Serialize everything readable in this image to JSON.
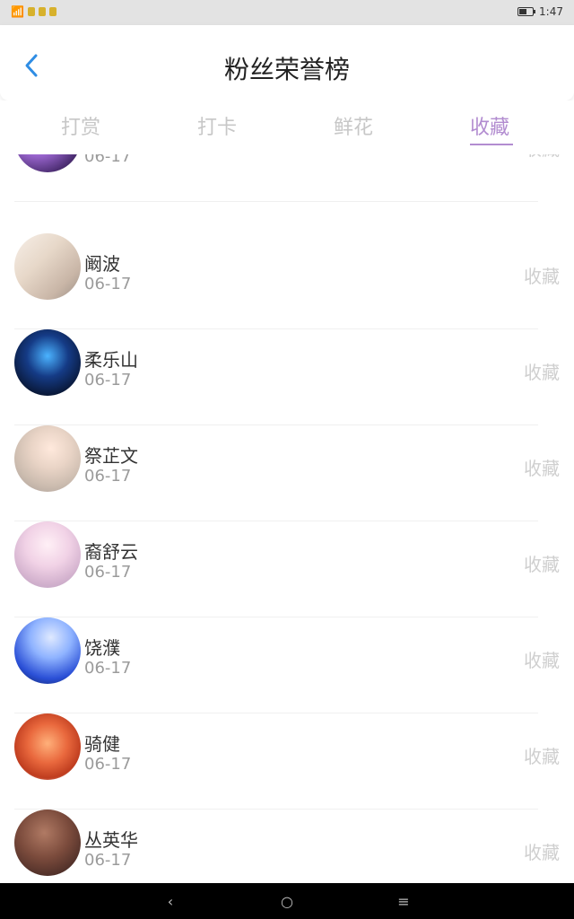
{
  "status": {
    "time": "1:47"
  },
  "header": {
    "title": "粉丝荣誉榜"
  },
  "tabs": [
    {
      "label": "打赏",
      "active": false
    },
    {
      "label": "打卡",
      "active": false
    },
    {
      "label": "鲜花",
      "active": false
    },
    {
      "label": "收藏",
      "active": true
    }
  ],
  "list": [
    {
      "name": "",
      "date": "06-17",
      "action": "收藏"
    },
    {
      "name": "阚波",
      "date": "06-17",
      "action": "收藏"
    },
    {
      "name": "柔乐山",
      "date": "06-17",
      "action": "收藏"
    },
    {
      "name": "祭芷文",
      "date": "06-17",
      "action": "收藏"
    },
    {
      "name": "裔舒云",
      "date": "06-17",
      "action": "收藏"
    },
    {
      "name": "饶濮",
      "date": "06-17",
      "action": "收藏"
    },
    {
      "name": "骑健",
      "date": "06-17",
      "action": "收藏"
    },
    {
      "name": "丛英华",
      "date": "06-17",
      "action": "收藏"
    }
  ],
  "navbar": {
    "back_icon": "‹",
    "home_icon": "○",
    "menu_icon": "≡"
  },
  "colors": {
    "accent": "#b28cd0",
    "back": "#2f8de4"
  }
}
